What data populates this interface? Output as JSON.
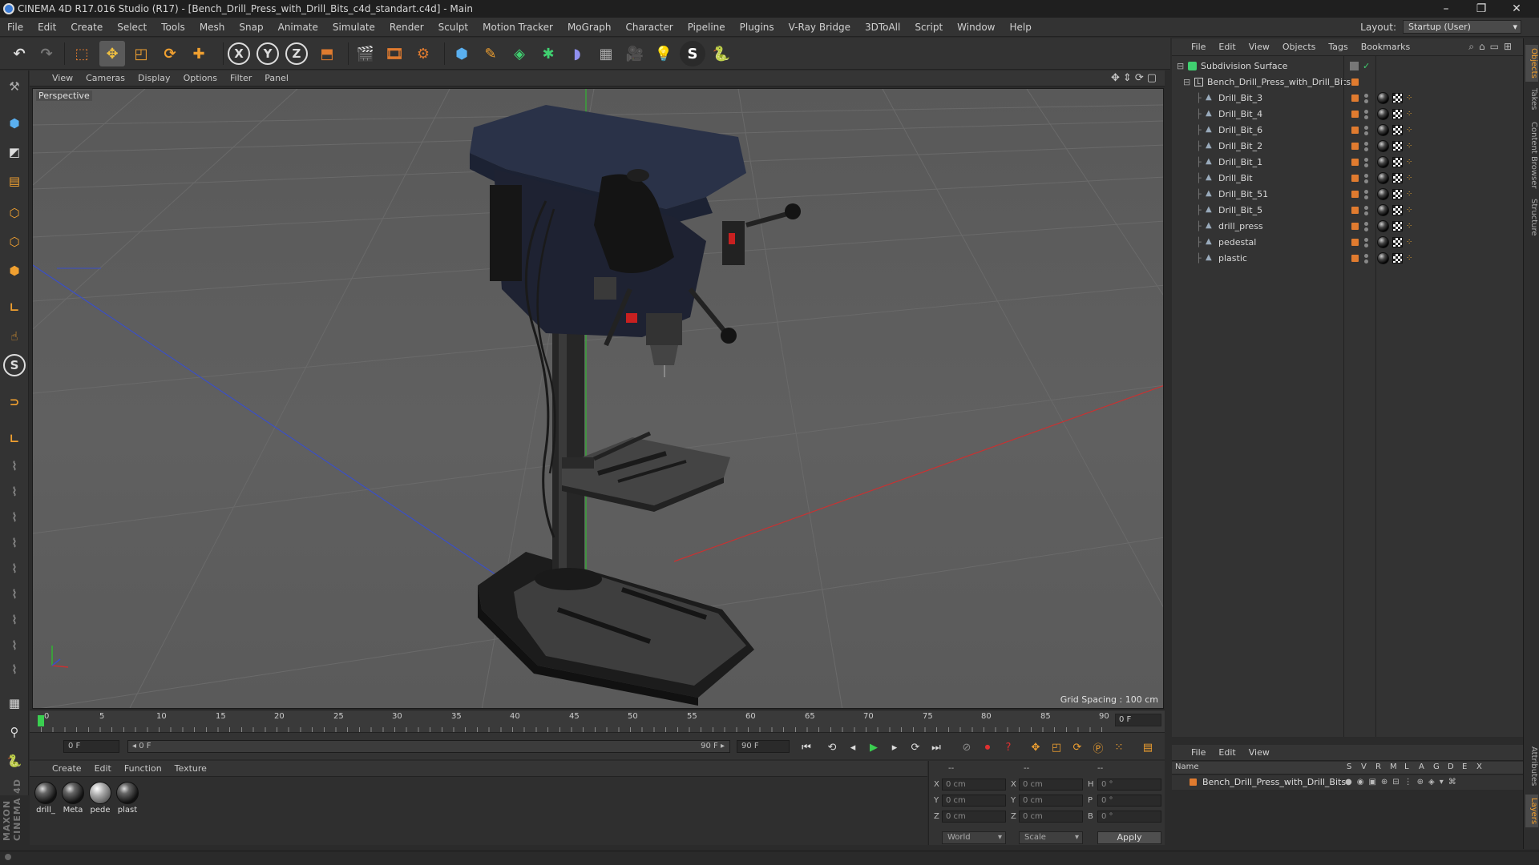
{
  "window": {
    "title": "CINEMA 4D R17.016 Studio (R17) - [Bench_Drill_Press_with_Drill_Bits_c4d_standart.c4d] - Main",
    "minimize": "–",
    "maximize": "❐",
    "close": "✕"
  },
  "menu": {
    "items": [
      "File",
      "Edit",
      "Create",
      "Select",
      "Tools",
      "Mesh",
      "Snap",
      "Animate",
      "Simulate",
      "Render",
      "Sculpt",
      "Motion Tracker",
      "MoGraph",
      "Character",
      "Pipeline",
      "Plugins",
      "V-Ray Bridge",
      "3DToAll",
      "Script",
      "Window",
      "Help"
    ],
    "layout_label": "Layout:",
    "layout_value": "Startup (User)"
  },
  "toolbar": {
    "axis_x": "X",
    "axis_y": "Y",
    "axis_z": "Z"
  },
  "viewport": {
    "menu": [
      "View",
      "Cameras",
      "Display",
      "Options",
      "Filter",
      "Panel"
    ],
    "label": "Perspective",
    "grid_spacing": "Grid Spacing : 100 cm",
    "nav_icons": "✥⇕⟳▢"
  },
  "timeline": {
    "ticks": [
      "0",
      "5",
      "10",
      "15",
      "20",
      "25",
      "30",
      "35",
      "40",
      "45",
      "50",
      "55",
      "60",
      "65",
      "70",
      "75",
      "80",
      "85",
      "90"
    ],
    "current_frame": "0 F"
  },
  "transport": {
    "start_field": "0 F",
    "range_start": "◂ 0 F",
    "range_end": "90 F ▸",
    "end_field": "90 F"
  },
  "materials": {
    "menu": [
      "Create",
      "Edit",
      "Function",
      "Texture"
    ],
    "items": [
      {
        "label": "drill_",
        "style": "dark"
      },
      {
        "label": "Meta",
        "style": "dark"
      },
      {
        "label": "pede",
        "style": "gray"
      },
      {
        "label": "plast",
        "style": "dark"
      }
    ]
  },
  "coordinates": {
    "header": [
      "--",
      "--",
      "--"
    ],
    "rows": [
      {
        "l1": "X",
        "v1": "0 cm",
        "l2": "X",
        "v2": "0 cm",
        "l3": "H",
        "v3": "0 °"
      },
      {
        "l1": "Y",
        "v1": "0 cm",
        "l2": "Y",
        "v2": "0 cm",
        "l3": "P",
        "v3": "0 °"
      },
      {
        "l1": "Z",
        "v1": "0 cm",
        "l2": "Z",
        "v2": "0 cm",
        "l3": "B",
        "v3": "0 °"
      }
    ],
    "mode1": "World",
    "mode2": "Scale",
    "apply": "Apply"
  },
  "objects": {
    "menu": [
      "File",
      "Edit",
      "View",
      "Objects",
      "Tags",
      "Bookmarks"
    ],
    "root": "Subdivision Surface",
    "group": "Bench_Drill_Press_with_Drill_Bits",
    "children": [
      "Drill_Bit_3",
      "Drill_Bit_4",
      "Drill_Bit_6",
      "Drill_Bit_2",
      "Drill_Bit_1",
      "Drill_Bit",
      "Drill_Bit_51",
      "Drill_Bit_5",
      "drill_press",
      "pedestal",
      "plastic"
    ]
  },
  "layers": {
    "menu": [
      "File",
      "Edit",
      "View"
    ],
    "columns": [
      "Name",
      "S",
      "V",
      "R",
      "M",
      "L",
      "A",
      "G",
      "D",
      "E",
      "X"
    ],
    "row": "Bench_Drill_Press_with_Drill_Bits"
  },
  "side_tabs": [
    "Objects",
    "Takes",
    "Content Browser",
    "Structure",
    "Attributes",
    "Layers"
  ],
  "logo": "MAXON CINEMA 4D",
  "colors": {
    "accent_orange": "#e07b2f",
    "axis_x_red": "#c83232",
    "axis_y_green": "#32b432",
    "axis_z_blue": "#3a4fc8"
  }
}
